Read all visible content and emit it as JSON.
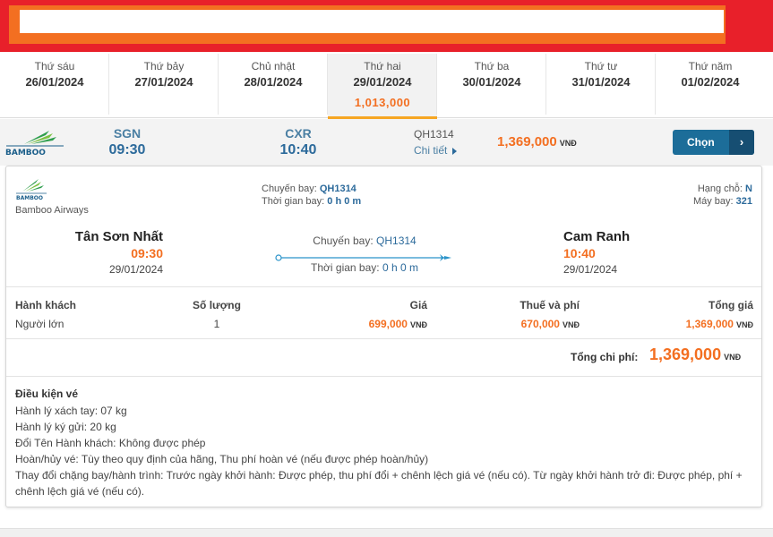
{
  "date_tabs": [
    {
      "dow": "Thứ sáu",
      "date": "26/01/2024",
      "price": ""
    },
    {
      "dow": "Thứ bảy",
      "date": "27/01/2024",
      "price": ""
    },
    {
      "dow": "Chủ nhật",
      "date": "28/01/2024",
      "price": ""
    },
    {
      "dow": "Thứ hai",
      "date": "29/01/2024",
      "price": "1,013,000"
    },
    {
      "dow": "Thứ ba",
      "date": "30/01/2024",
      "price": ""
    },
    {
      "dow": "Thứ tư",
      "date": "31/01/2024",
      "price": ""
    },
    {
      "dow": "Thứ năm",
      "date": "01/02/2024",
      "price": ""
    }
  ],
  "flight_row": {
    "from_code": "SGN",
    "from_time": "09:30",
    "to_code": "CXR",
    "to_time": "10:40",
    "flight_no": "QH1314",
    "detail_label": "Chi tiết",
    "price": "1,369,000",
    "currency": "VNĐ",
    "select_label": "Chọn",
    "select_arrow": "›",
    "logo_text": "BAMBOO"
  },
  "detail": {
    "logo_text": "BAMBOO",
    "airline": "Bamboo Airways",
    "flight_label": "Chuyến bay:",
    "flight_value": "QH1314",
    "duration_label": "Thời gian bay:",
    "duration_value": "0 h 0 m",
    "class_label": "Hạng chỗ:",
    "class_value": "N",
    "aircraft_label": "Máy bay:",
    "aircraft_value": "321",
    "from_city": "Tân Sơn Nhất",
    "from_time": "09:30",
    "from_date": "29/01/2024",
    "to_city": "Cam Ranh",
    "to_time": "10:40",
    "to_date": "29/01/2024"
  },
  "fare_table": {
    "headers": [
      "Hành khách",
      "Số lượng",
      "Giá",
      "Thuế và phí",
      "Tổng giá"
    ],
    "rows": [
      {
        "passenger": "Người lớn",
        "qty": "1",
        "price": "699,000",
        "tax": "670,000",
        "total": "1,369,000"
      }
    ],
    "currency": "VNĐ",
    "total_label": "Tổng chi phí:",
    "total_value": "1,369,000"
  },
  "conditions": {
    "title": "Điều kiện vé",
    "lines": [
      "Hành lý xách tay: 07 kg",
      "Hành lý ký gửi: 20 kg",
      "Đổi Tên Hành khách: Không được phép",
      "Hoàn/hủy vé: Tùy theo quy định của hãng, Thu phí hoàn vé (nếu được phép hoàn/hủy)",
      "Thay đổi chặng bay/hành trình: Trước ngày khởi hành: Được phép, thu phí đổi + chênh lệch giá vé (nếu có). Từ ngày khởi hành trở đi: Được phép, phí + chênh lệch giá vé (nếu có)."
    ]
  },
  "colors": {
    "brand_red": "#e8202a",
    "brand_orange": "#f36f21",
    "accent_blue": "#1c6d99",
    "bamboo_green": "#2e9e4d"
  }
}
